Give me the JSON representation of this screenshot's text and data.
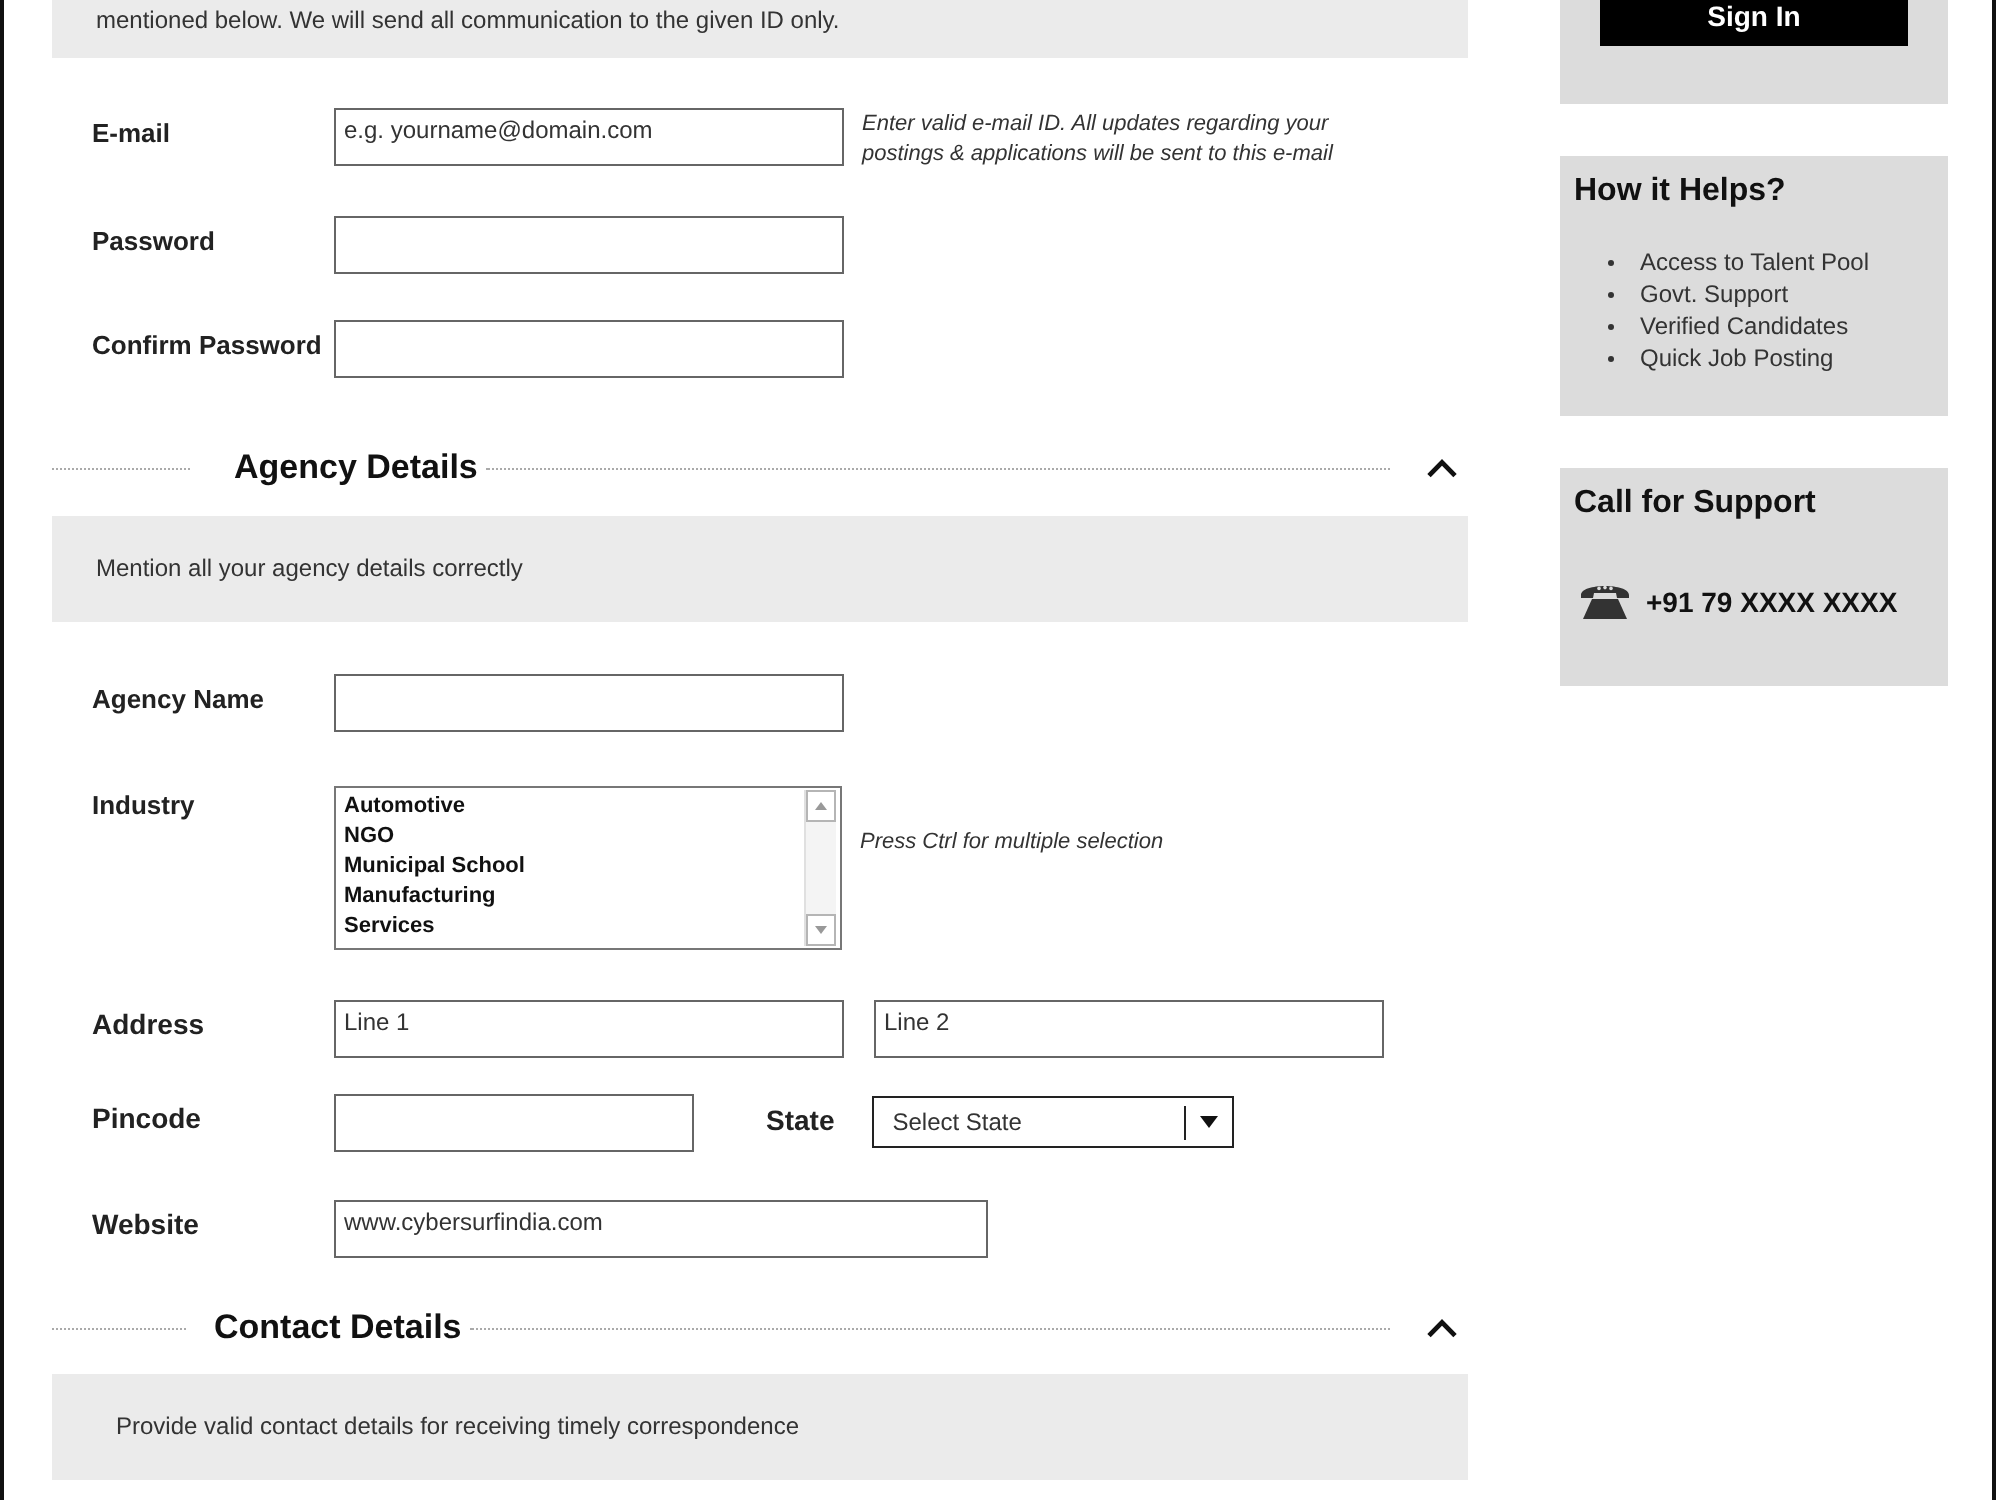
{
  "intro": {
    "text": "mentioned below. We will send all communication to the given ID only."
  },
  "account": {
    "rows": [
      {
        "label": "E-mail",
        "controls": [
          {
            "kind": "field",
            "placeholder": "e.g. yourname@domain.com"
          }
        ],
        "hint": "Enter valid e-mail ID. All updates regarding your postings & applications will be sent to this e-mail"
      },
      {
        "label": "Password",
        "controls": [
          {
            "kind": "field"
          }
        ]
      },
      {
        "label": "Confirm Password",
        "controls": [
          {
            "kind": "field"
          }
        ]
      }
    ]
  },
  "sections": [
    {
      "title": "Agency Details",
      "expanded": true,
      "description": "Mention all your agency details correctly",
      "rows": [
        {
          "label": "Agency Name",
          "controls": [
            {
              "kind": "field"
            }
          ]
        },
        {
          "label": "Industry",
          "controls": [
            {
              "kind": "listbox",
              "options": [
                {
                  "label": "Automotive",
                  "selected": false
                },
                {
                  "label": "NGO",
                  "selected": false
                },
                {
                  "label": "Municipal School",
                  "selected": false
                },
                {
                  "label": "Manufacturing",
                  "selected": false
                },
                {
                  "label": "Services",
                  "selected": false
                }
              ]
            }
          ],
          "hint": "Press Ctrl for multiple selection"
        },
        {
          "label": "Address",
          "controls": [
            {
              "kind": "field",
              "placeholder": "Line 1"
            },
            {
              "kind": "field",
              "placeholder": "Line 2"
            }
          ]
        },
        {
          "label": "Pincode",
          "controls": [
            {
              "kind": "short"
            },
            {
              "kind": "select",
              "label": "State",
              "value": "Select State"
            }
          ]
        },
        {
          "label": "Website",
          "controls": [
            {
              "kind": "wide",
              "value": "www.cybersurfindia.com"
            }
          ]
        }
      ]
    },
    {
      "title": "Contact Details",
      "expanded": true,
      "description": "Provide valid contact details for receiving timely correspondence"
    }
  ],
  "sidebar": {
    "sign_in": {
      "button": "Sign In"
    },
    "benefits": {
      "title": "How it Helps?",
      "items": [
        "Access to Talent Pool",
        "Govt. Support",
        "Verified Candidates",
        "Quick Job Posting"
      ]
    },
    "support": {
      "title": "Call for Support",
      "phone": "+91 79 XXXX XXXX"
    }
  }
}
